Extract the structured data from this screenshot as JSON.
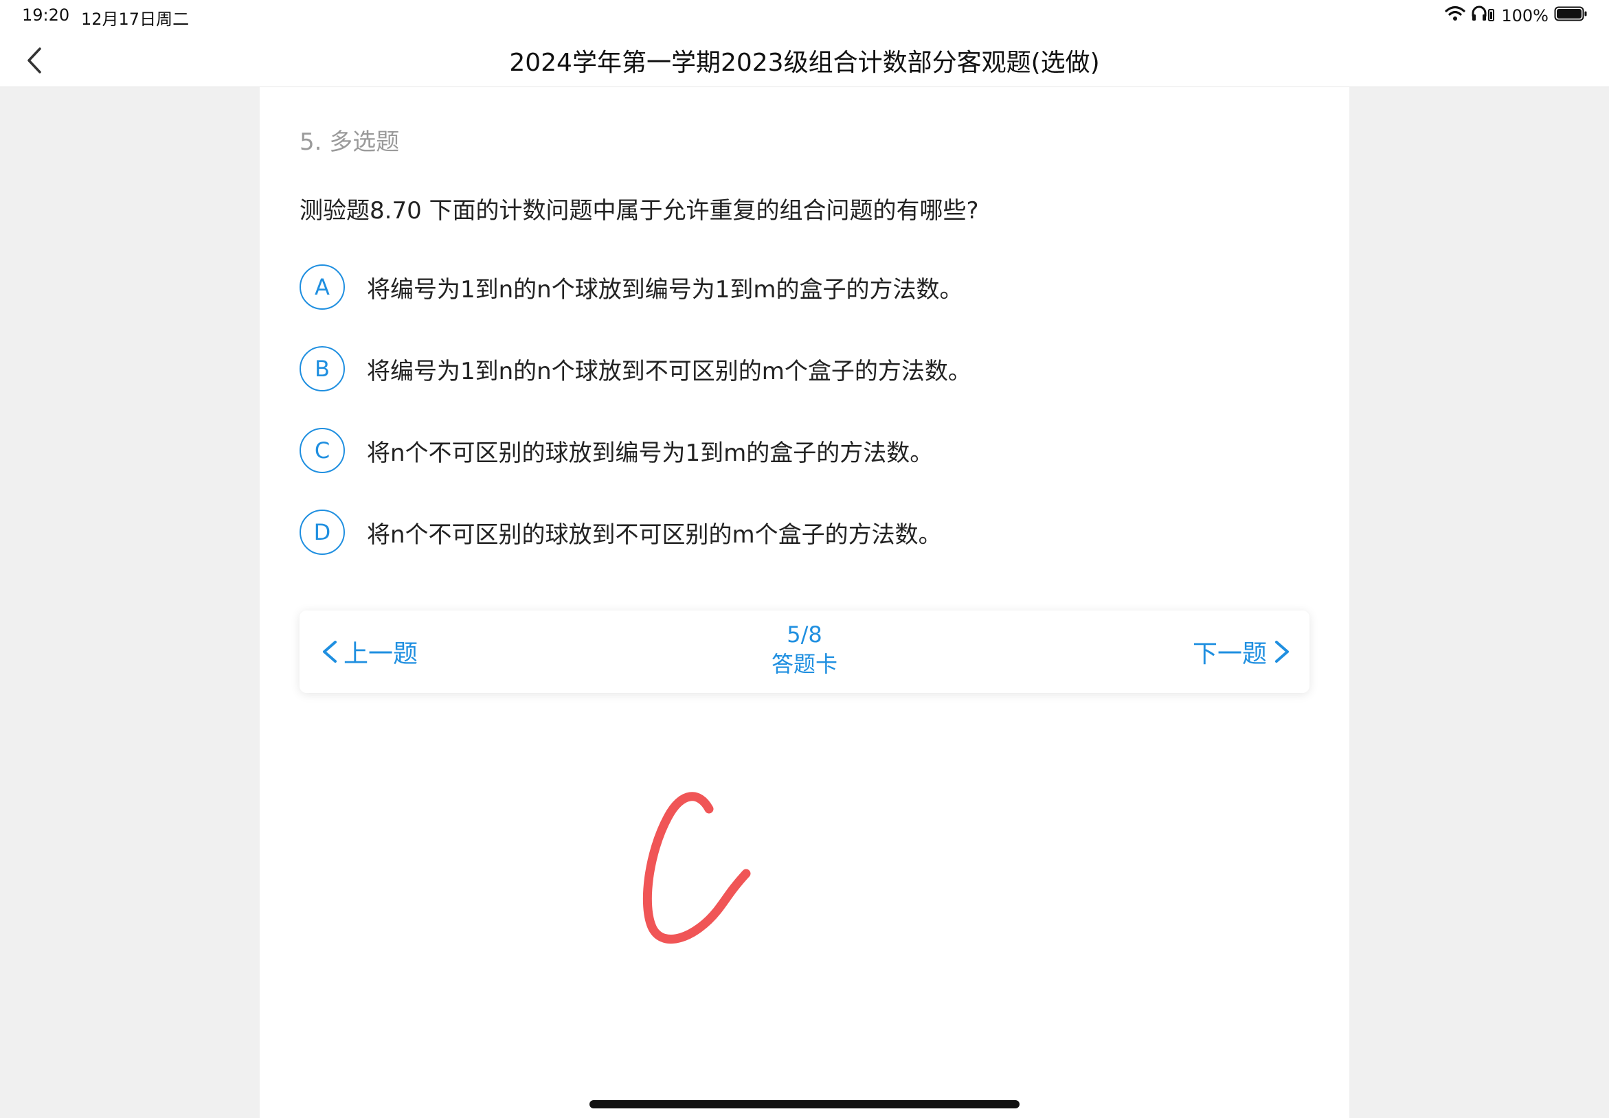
{
  "status_bar": {
    "time": "19:20",
    "date": "12月17日周二",
    "battery": "100%"
  },
  "header": {
    "title": "2024学年第一学期2023级组合计数部分客观题(选做)"
  },
  "question": {
    "type_label": "5. 多选题",
    "text": "测验题8.70 下面的计数问题中属于允许重复的组合问题的有哪些?",
    "options": [
      {
        "letter": "A",
        "text": "将编号为1到n的n个球放到编号为1到m的盒子的方法数。"
      },
      {
        "letter": "B",
        "text": "将编号为1到n的n个球放到不可区别的m个盒子的方法数。"
      },
      {
        "letter": "C",
        "text": "将n个不可区别的球放到编号为1到m的盒子的方法数。"
      },
      {
        "letter": "D",
        "text": "将n个不可区别的球放到不可区别的m个盒子的方法数。"
      }
    ]
  },
  "pager": {
    "prev_label": "上一题",
    "next_label": "下一题",
    "progress": "5/8",
    "answer_card_label": "答题卡"
  },
  "handwritten_answer": "C",
  "colors": {
    "accent": "#1f8fe0",
    "handwriting": "#f05556"
  }
}
